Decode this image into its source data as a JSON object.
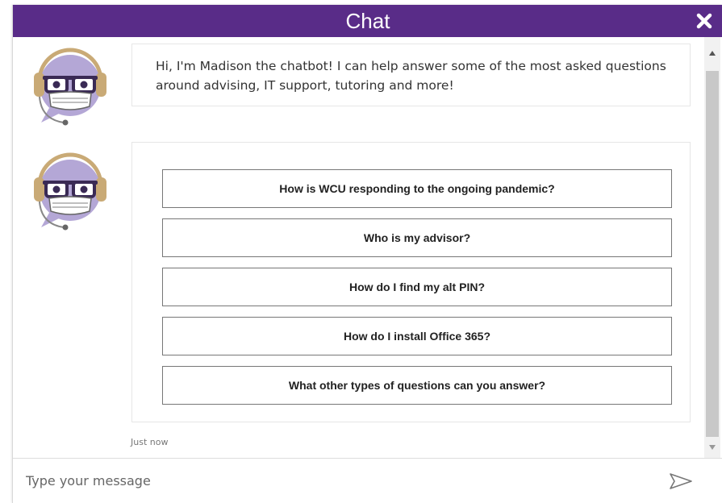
{
  "header": {
    "title": "Chat",
    "close_icon": "close-icon",
    "background": "#592c88"
  },
  "messages": [
    {
      "avatar": "chatbot-avatar",
      "text": "Hi, I'm Madison the chatbot! I can help answer some of the most asked questions around advising, IT support, tutoring and more!"
    },
    {
      "avatar": "chatbot-avatar",
      "options": [
        "How is WCU responding to the ongoing pandemic?",
        "Who is my advisor?",
        "How do I find my alt PIN?",
        "How do I install Office 365?",
        "What other types of questions can you answer?"
      ]
    }
  ],
  "timestamp": "Just now",
  "input": {
    "placeholder": "Type your message",
    "send_icon": "send-icon"
  },
  "colors": {
    "header": "#592c88",
    "avatar_face": "#b4a7d6",
    "headset": "#c9aa76"
  }
}
